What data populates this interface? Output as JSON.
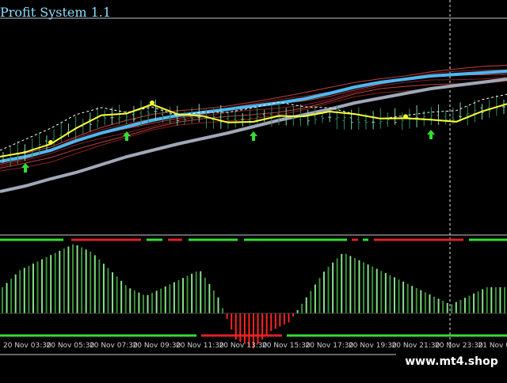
{
  "window": {
    "title": "Profit System 1.1",
    "watermark": "www.mt4.shop"
  },
  "colors": {
    "background": "#000000",
    "candle_green": "#2e8b57",
    "candle_light": "#7fd8a8",
    "yellow_line": "#ffff33",
    "blue_ma": "#4fb6f0",
    "gray_ma": "#a0a8b8",
    "red_ma": "#b03030",
    "signal_green": "#33dd33",
    "signal_red": "#dd2222",
    "histo_green": "#3a8f3a",
    "histo_light": "#88e088",
    "histo_red": "#ff2222",
    "separator": "#c8c8c8"
  },
  "chart_data": {
    "type": "line",
    "symbol_title": "Profit System 1.1",
    "x_labels": [
      "20 Nov 03:30",
      "20 Nov 05:30",
      "20 Nov 07:30",
      "20 Nov 09:30",
      "20 Nov 11:30",
      "20 Nov 13:30",
      "20 Nov 15:30",
      "20 Nov 17:30",
      "20 Nov 19:30",
      "20 Nov 21:30",
      "20 Nov 23:30",
      "21 Nov 0"
    ],
    "series": [
      {
        "values": [
          200,
          190,
          178,
          160,
          148,
          150,
          140,
          150,
          148,
          152,
          150,
          145,
          150,
          148,
          152,
          155,
          150,
          148,
          150,
          140,
          135
        ]
      },
      {
        "values": [
          204,
          198,
          190,
          178,
          168,
          160,
          152,
          146,
          142,
          138,
          134,
          130,
          125,
          118,
          110,
          104,
          100,
          96,
          94,
          92,
          90
        ]
      },
      {
        "values": [
          242,
          235,
          226,
          218,
          208,
          198,
          190,
          182,
          175,
          168,
          160,
          152,
          145,
          138,
          130,
          124,
          118,
          112,
          108,
          104,
          100
        ]
      }
    ],
    "signal_arrows_up": [
      1,
      5,
      10,
      17
    ],
    "dots": [
      2,
      6,
      16
    ],
    "histogram_values": [
      3,
      5,
      6,
      7,
      8,
      7,
      5,
      3,
      2,
      3,
      4,
      5,
      2,
      -3,
      -4,
      -2,
      -1,
      2,
      5,
      7,
      6,
      5,
      4,
      3,
      2,
      1,
      2,
      3,
      3
    ]
  }
}
